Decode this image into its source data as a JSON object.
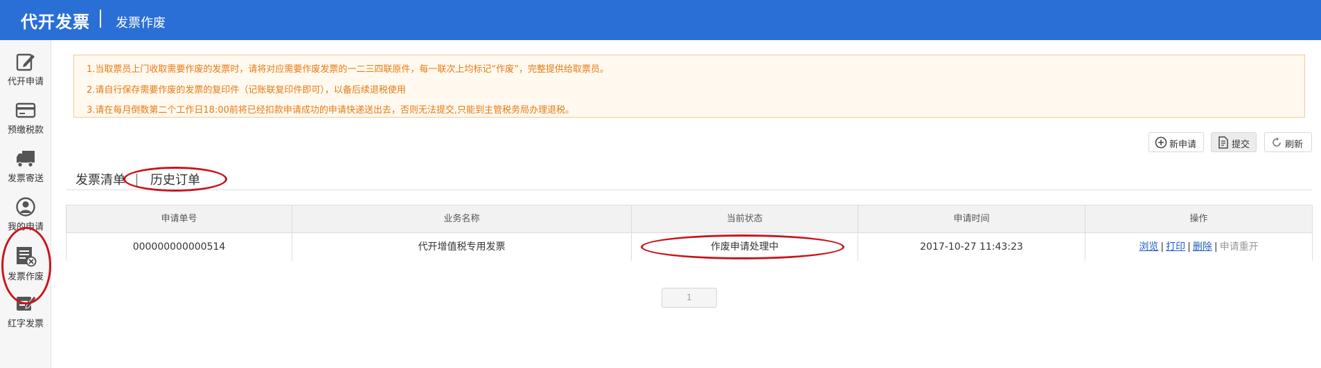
{
  "header": {
    "brand": "代开发票",
    "subtitle": "发票作废"
  },
  "sidebar": {
    "items": [
      {
        "label": "代开申请",
        "icon": "edit-icon"
      },
      {
        "label": "预缴税款",
        "icon": "card-icon"
      },
      {
        "label": "发票寄送",
        "icon": "truck-icon"
      },
      {
        "label": "我的申请",
        "icon": "user-icon"
      },
      {
        "label": "发票作废",
        "icon": "invoice-void-icon",
        "active": true
      },
      {
        "label": "红字发票",
        "icon": "red-invoice-icon"
      }
    ]
  },
  "notice": {
    "lines": [
      "1.当取票员上门收取需要作废的发票时，请将对应需要作废发票的一二三四联原件，每一联次上均标记“作废”，完整提供给取票员。",
      "2.请自行保存需要作废的发票的复印件（记账联复印件即可），以备后续退税使用",
      "3.请在每月倒数第二个工作日18:00前将已经扣款申请成功的申请快递送出去，否则无法提交,只能到主管税务局办理退税。"
    ]
  },
  "toolbar": {
    "new_label": "新申请",
    "submit_label": "提交",
    "refresh_label": "刷新"
  },
  "tabs": {
    "invoice_list": "发票清单",
    "history_orders": "历史订单"
  },
  "table": {
    "columns": [
      "申请单号",
      "业务名称",
      "当前状态",
      "申请时间",
      "操作"
    ],
    "rows": [
      {
        "order_no": "000000000000514",
        "business": "代开增值税专用发票",
        "status": "作废申请处理中",
        "time": "2017-10-27 11:43:23",
        "actions": {
          "view": "浏览",
          "print": "打印",
          "delete": "删除",
          "reapply": "申请重开"
        }
      }
    ]
  },
  "pager": {
    "current": "1"
  },
  "colors": {
    "header_bg": "#2a6fd6",
    "notice_text": "#e87a12",
    "annotation": "#c8141b",
    "link": "#1f5fc0"
  }
}
